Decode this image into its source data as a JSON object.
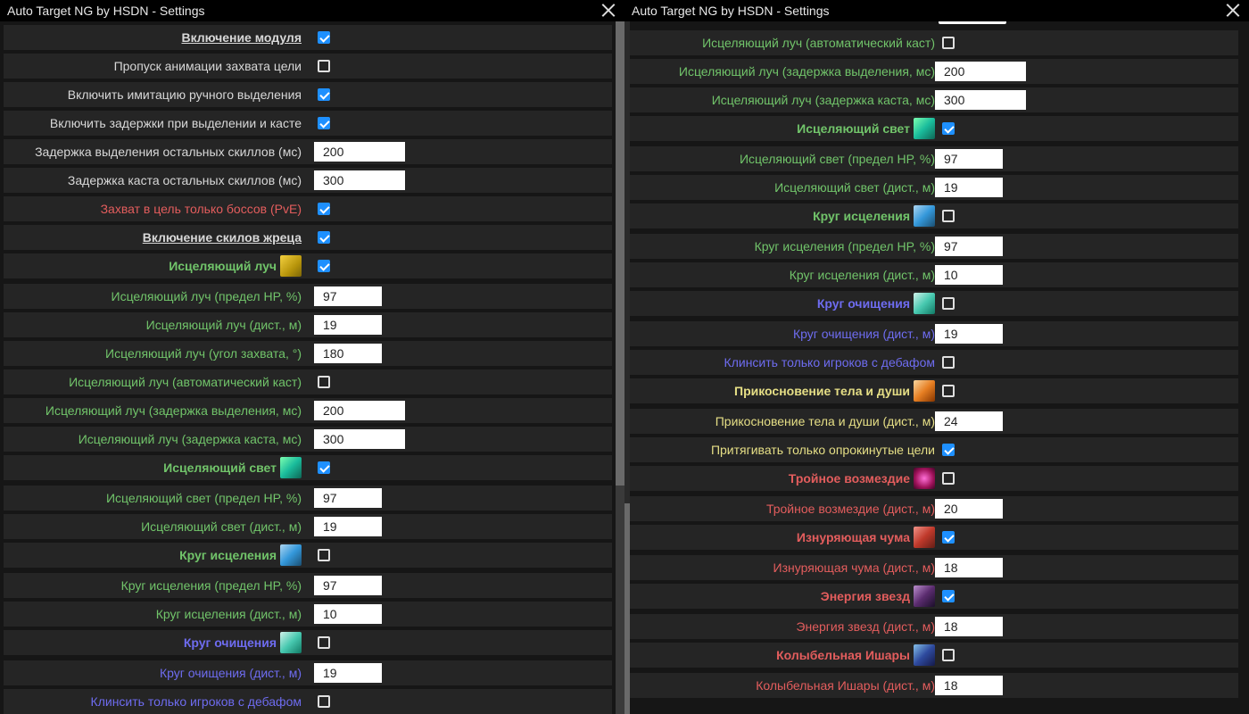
{
  "left_window": {
    "title": "Auto Target NG by HSDN - Settings",
    "rows": [
      {
        "label": "Включение модуля",
        "color": "white",
        "bold": true,
        "underline": true,
        "control": "checkbox",
        "checked": true
      },
      {
        "label": "Пропуск анимации захвата цели",
        "color": "white",
        "control": "checkbox",
        "checked": false
      },
      {
        "label": "Включить имитацию ручного выделения",
        "color": "white",
        "control": "checkbox",
        "checked": true
      },
      {
        "label": "Включить задержки при выделении и касте",
        "color": "white",
        "control": "checkbox",
        "checked": true
      },
      {
        "label": "Задержка выделения остальных скиллов (мс)",
        "color": "white",
        "control": "input",
        "value": "200",
        "width": "w1"
      },
      {
        "label": "Задержка каста остальных скиллов (мс)",
        "color": "white",
        "control": "input",
        "value": "300",
        "width": "w1"
      },
      {
        "label": "Захват в цель только боссов (PvE)",
        "color": "red",
        "control": "checkbox",
        "checked": true
      },
      {
        "label": "Включение скилов жреца",
        "color": "white",
        "bold": true,
        "underline": true,
        "control": "checkbox",
        "checked": true
      },
      {
        "label": "Исцеляющий луч",
        "color": "green",
        "bold": true,
        "icon": "ic-yellow",
        "icon_name": "healing-ray-icon",
        "control": "checkbox",
        "checked": true
      },
      {
        "label": "Исцеляющий луч (предел HP, %)",
        "color": "green",
        "control": "input",
        "value": "97",
        "width": "w2"
      },
      {
        "label": "Исцеляющий луч (дист., м)",
        "color": "green",
        "control": "input",
        "value": "19",
        "width": "w2"
      },
      {
        "label": "Исцеляющий луч (угол захвата, °)",
        "color": "green",
        "control": "input",
        "value": "180",
        "width": "w2"
      },
      {
        "label": "Исцеляющий луч (автоматический каст)",
        "color": "green",
        "control": "checkbox",
        "checked": false
      },
      {
        "label": "Исцеляющий луч (задержка выделения, мс)",
        "color": "green",
        "control": "input",
        "value": "200",
        "width": "w1"
      },
      {
        "label": "Исцеляющий луч (задержка каста, мс)",
        "color": "green",
        "control": "input",
        "value": "300",
        "width": "w1"
      },
      {
        "label": "Исцеляющий свет",
        "color": "green",
        "bold": true,
        "icon": "ic-teal",
        "icon_name": "healing-light-icon",
        "control": "checkbox",
        "checked": true
      },
      {
        "label": "Исцеляющий свет (предел HP, %)",
        "color": "green",
        "control": "input",
        "value": "97",
        "width": "w2"
      },
      {
        "label": "Исцеляющий свет (дист., м)",
        "color": "green",
        "control": "input",
        "value": "19",
        "width": "w2"
      },
      {
        "label": "Круг исцеления",
        "color": "green",
        "bold": true,
        "icon": "ic-blue",
        "icon_name": "healing-circle-icon",
        "control": "checkbox",
        "checked": false
      },
      {
        "label": "Круг исцеления (предел HP, %)",
        "color": "green",
        "control": "input",
        "value": "97",
        "width": "w2"
      },
      {
        "label": "Круг исцеления (дист., м)",
        "color": "green",
        "control": "input",
        "value": "10",
        "width": "w2"
      },
      {
        "label": "Круг очищения",
        "color": "blue",
        "bold": true,
        "icon": "ic-cyan",
        "icon_name": "cleansing-circle-icon",
        "control": "checkbox",
        "checked": false
      },
      {
        "label": "Круг очищения (дист., м)",
        "color": "blue",
        "control": "input",
        "value": "19",
        "width": "w2"
      },
      {
        "label": "Клинсить только игроков с дебафом",
        "color": "blue",
        "control": "checkbox",
        "checked": false
      }
    ]
  },
  "right_window": {
    "title": "Auto Target NG by HSDN - Settings",
    "rows": [
      {
        "label": "Исцеляющий луч (автоматический каст)",
        "color": "green",
        "control": "checkbox",
        "checked": false
      },
      {
        "label": "Исцеляющий луч (задержка выделения, мс)",
        "color": "green",
        "control": "input",
        "value": "200",
        "width": "w1"
      },
      {
        "label": "Исцеляющий луч (задержка каста, мс)",
        "color": "green",
        "control": "input",
        "value": "300",
        "width": "w1"
      },
      {
        "label": "Исцеляющий свет",
        "color": "green",
        "bold": true,
        "icon": "ic-teal",
        "icon_name": "healing-light-icon",
        "control": "checkbox",
        "checked": true
      },
      {
        "label": "Исцеляющий свет (предел HP, %)",
        "color": "green",
        "control": "input",
        "value": "97",
        "width": "w2"
      },
      {
        "label": "Исцеляющий свет (дист., м)",
        "color": "green",
        "control": "input",
        "value": "19",
        "width": "w2"
      },
      {
        "label": "Круг исцеления",
        "color": "green",
        "bold": true,
        "icon": "ic-blue",
        "icon_name": "healing-circle-icon",
        "control": "checkbox",
        "checked": false
      },
      {
        "label": "Круг исцеления (предел HP, %)",
        "color": "green",
        "control": "input",
        "value": "97",
        "width": "w2"
      },
      {
        "label": "Круг исцеления (дист., м)",
        "color": "green",
        "control": "input",
        "value": "10",
        "width": "w2"
      },
      {
        "label": "Круг очищения",
        "color": "blue",
        "bold": true,
        "icon": "ic-cyan",
        "icon_name": "cleansing-circle-icon",
        "control": "checkbox",
        "checked": false
      },
      {
        "label": "Круг очищения (дист., м)",
        "color": "blue",
        "control": "input",
        "value": "19",
        "width": "w2"
      },
      {
        "label": "Клинсить только игроков с дебафом",
        "color": "blue",
        "control": "checkbox",
        "checked": false
      },
      {
        "label": "Прикосновение тела и души",
        "color": "yellow",
        "bold": true,
        "icon": "ic-orange",
        "icon_name": "body-soul-touch-icon",
        "control": "checkbox",
        "checked": false
      },
      {
        "label": "Прикосновение тела и души (дист., м)",
        "color": "yellow",
        "control": "input",
        "value": "24",
        "width": "w2"
      },
      {
        "label": "Притягивать только опрокинутые цели",
        "color": "yellow",
        "control": "checkbox",
        "checked": true
      },
      {
        "label": "Тройное возмездие",
        "color": "red",
        "bold": true,
        "icon": "ic-pink",
        "icon_name": "triple-retribution-icon",
        "control": "checkbox",
        "checked": false
      },
      {
        "label": "Тройное возмездие (дист., м)",
        "color": "red",
        "control": "input",
        "value": "20",
        "width": "w2"
      },
      {
        "label": "Изнуряющая чума",
        "color": "red",
        "bold": true,
        "icon": "ic-red",
        "icon_name": "exhausting-plague-icon",
        "control": "checkbox",
        "checked": true
      },
      {
        "label": "Изнуряющая чума (дист., м)",
        "color": "red",
        "control": "input",
        "value": "18",
        "width": "w2"
      },
      {
        "label": "Энергия звезд",
        "color": "red",
        "bold": true,
        "icon": "ic-purple",
        "icon_name": "star-energy-icon",
        "control": "checkbox",
        "checked": true
      },
      {
        "label": "Энергия звезд (дист., м)",
        "color": "red",
        "control": "input",
        "value": "18",
        "width": "w2"
      },
      {
        "label": "Колыбельная Ишары",
        "color": "red",
        "bold": true,
        "icon": "ic-navy",
        "icon_name": "ishara-lullaby-icon",
        "control": "checkbox",
        "checked": false
      },
      {
        "label": "Колыбельная Ишары (дист., м)",
        "color": "red",
        "control": "input",
        "value": "18",
        "width": "w2"
      }
    ]
  }
}
